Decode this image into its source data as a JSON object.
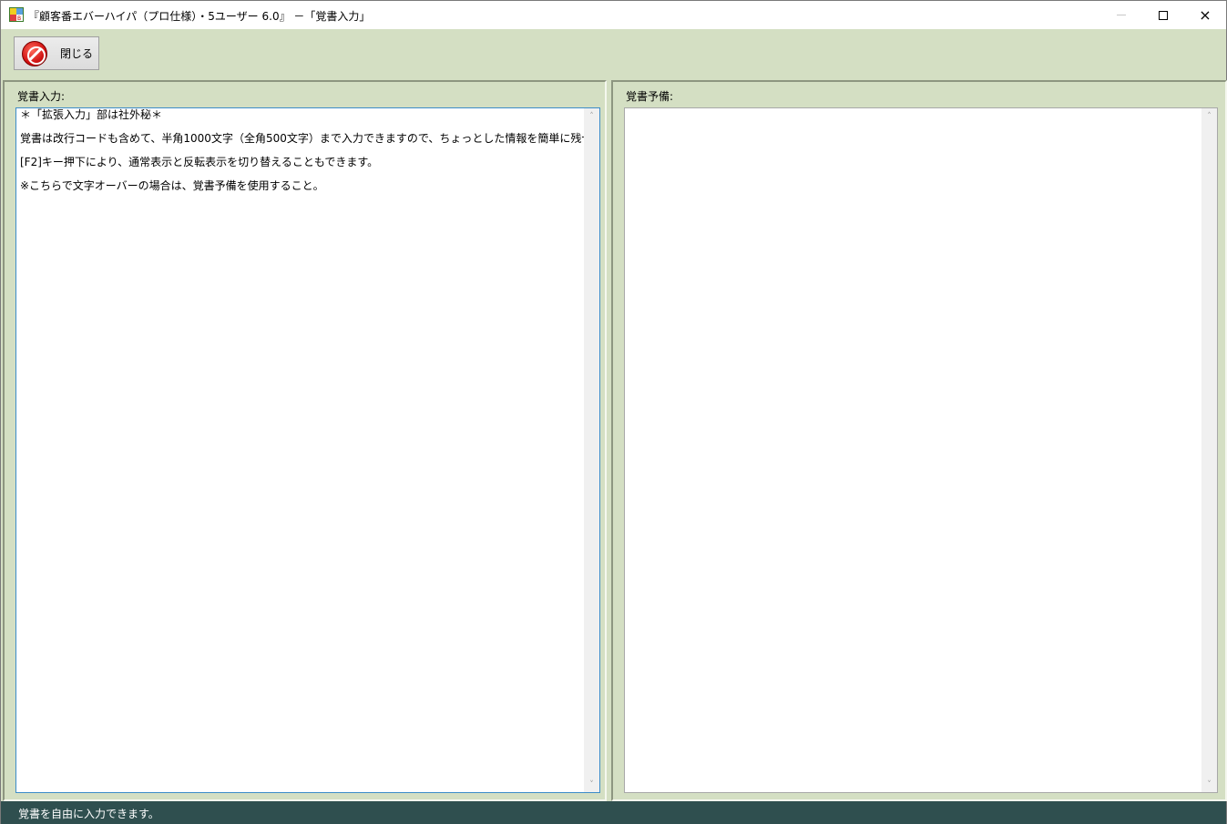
{
  "window": {
    "title": "『顧客番エバーハイパ（プロ仕様）・5ユーザー 6.0』 －「覚書入力」",
    "icon": "app-icon",
    "controls": {
      "minimize": "minimize-icon",
      "maximize": "maximize-icon",
      "close": "×"
    }
  },
  "toolbar": {
    "close_label": "閉じる",
    "close_icon": "stop-icon"
  },
  "memo_input": {
    "label": "覚書入力:",
    "lines": [
      "＊「拡張入力」部は社外秘＊",
      "覚書は改行コードも含めて、半角1000文字（全角500文字）まで入力できますので、ちょっとした情報を簡単に残せます。",
      "[F2]キー押下により、通常表示と反転表示を切り替えることもできます。",
      "※こちらで文字オーバーの場合は、覚書予備を使用すること。"
    ]
  },
  "memo_spare": {
    "label": "覚書予備:",
    "value": ""
  },
  "scrollbar": {
    "up": "˄",
    "down": "˅"
  },
  "status": {
    "text": "覚書を自由に入力できます。"
  },
  "colors": {
    "background": "#d4dfc3",
    "statusbar": "#2f4f4f",
    "focus_border": "#3c8cc8",
    "stop_icon": "#d01010"
  }
}
